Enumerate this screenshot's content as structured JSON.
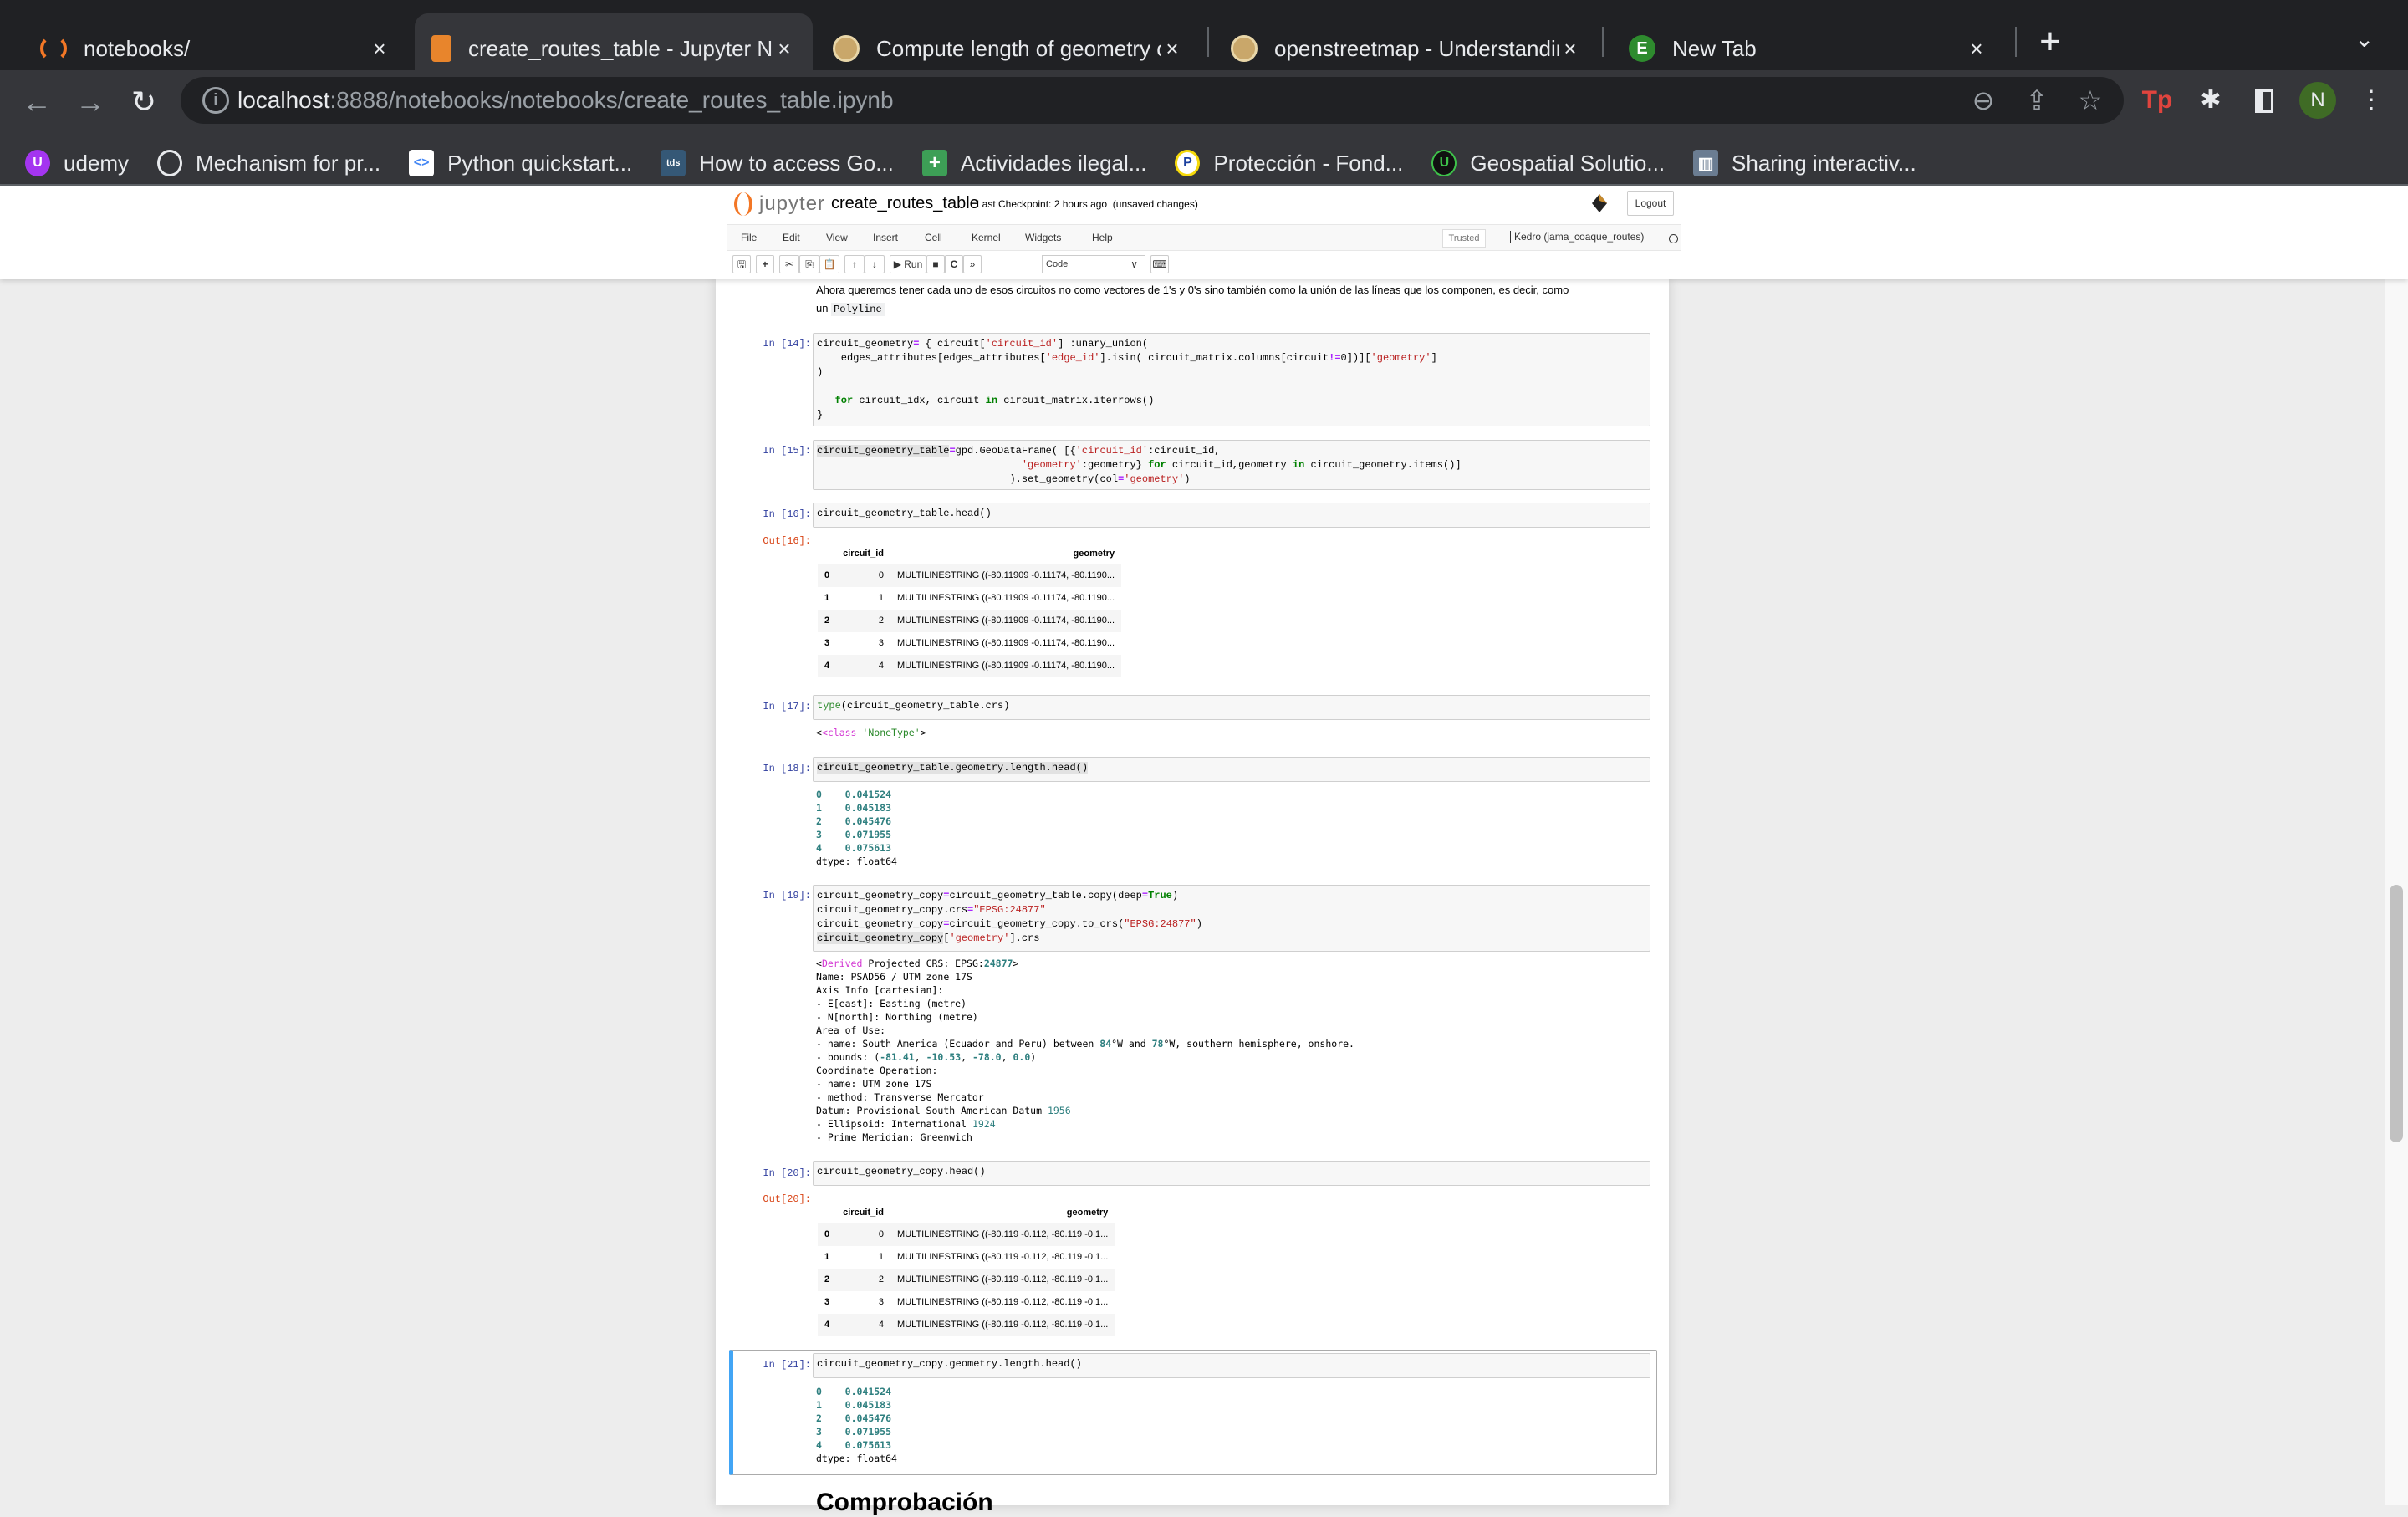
{
  "browser": {
    "tabs": [
      {
        "label": "notebooks/",
        "icon": "jupyter-icon",
        "active": false
      },
      {
        "label": "create_routes_table - Jupyter N",
        "icon": "notebook-icon",
        "active": true
      },
      {
        "label": "Compute length of geometry c",
        "icon": "gis-stackexchange-icon",
        "active": false
      },
      {
        "label": "openstreetmap - Understandin",
        "icon": "gis-stackexchange-icon",
        "active": false
      },
      {
        "label": "New Tab",
        "icon": "evernote-icon",
        "active": false
      }
    ],
    "close_glyph": "×",
    "new_tab_glyph": "+",
    "tab_search_glyph": "⌄",
    "url_host": "localhost",
    "url_rest": ":8888/notebooks/notebooks/create_routes_table.ipynb",
    "avatar_letter": "N",
    "bookmarks": [
      {
        "label": "udemy",
        "icon": "udemy-icon",
        "glyph": "U",
        "color": "#a435f0"
      },
      {
        "label": "Mechanism for pr...",
        "icon": "github-icon",
        "glyph": "◯",
        "color": "#35363a"
      },
      {
        "label": "Python quickstart...",
        "icon": "google-dev-icon",
        "glyph": "<>",
        "color": "#ffffff"
      },
      {
        "label": "How to access Go...",
        "icon": "tds-icon",
        "glyph": "tds",
        "color": "#355876"
      },
      {
        "label": "Actividades ilegal...",
        "icon": "google-sheets-icon",
        "glyph": "+",
        "color": "#3d9f56"
      },
      {
        "label": "Protección - Fond...",
        "icon": "p-icon",
        "glyph": "P",
        "color": "#f5d90a"
      },
      {
        "label": "Geospatial Solutio...",
        "icon": "geospatial-icon",
        "glyph": "U",
        "color": "#111111"
      },
      {
        "label": "Sharing interactiv...",
        "icon": "columns-icon",
        "glyph": "▥",
        "color": "#6b7d92"
      }
    ]
  },
  "jupyter": {
    "logo_text": "jupyter",
    "notebook_name": "create_routes_table",
    "checkpoint": "Last Checkpoint: 2 hours ago",
    "unsaved": "(unsaved changes)",
    "logout": "Logout",
    "menu": [
      "File",
      "Edit",
      "View",
      "Insert",
      "Cell",
      "Kernel",
      "Widgets",
      "Help"
    ],
    "trusted": "Trusted",
    "kernel": "Kedro (jama_coaque_routes)",
    "toolbar": {
      "save": "🖫",
      "add": "+",
      "cut": "✂",
      "copy": "⎘",
      "paste": "📋",
      "up": "🡑",
      "down": "🡓",
      "run": "▶ Run",
      "stop": "■",
      "restart": "C",
      "fastforward": "⏩",
      "cell_type": "Code",
      "cell_type_chevron": "∨",
      "keyboard": "⌨"
    }
  },
  "notebook": {
    "markdown_intro_line1": "Ahora queremos tener cada uno de esos circuitos no como vectores de 1's y 0's sino también como la unión de las líneas que los componen, es decir, como",
    "markdown_intro_line2_prefix": "un",
    "markdown_intro_code": "Polyline",
    "cells": {
      "c14": {
        "prompt": "In [14]:"
      },
      "c15": {
        "prompt": "In [15]:"
      },
      "c16": {
        "prompt": "In [16]:",
        "code": "circuit_geometry_table.head()",
        "out_prompt": "Out[16]:"
      },
      "c17": {
        "prompt": "In [17]:",
        "out_class": "<class",
        "out_type": "'NoneType'",
        "out_end": ">"
      },
      "c18": {
        "prompt": "In [18]:",
        "code": "circuit_geometry_table.geometry.length.head()"
      },
      "c19": {
        "prompt": "In [19]:"
      },
      "c20": {
        "prompt": "In [20]:",
        "code": "circuit_geometry_copy.head()",
        "out_prompt": "Out[20]:"
      },
      "c21": {
        "prompt": "In [21]:",
        "code": "circuit_geometry_copy.geometry.length.head()"
      }
    },
    "table16": {
      "columns": [
        "",
        "circuit_id",
        "geometry"
      ],
      "rows": [
        [
          "0",
          "0",
          "MULTILINESTRING ((-80.11909 -0.11174, -80.1190..."
        ],
        [
          "1",
          "1",
          "MULTILINESTRING ((-80.11909 -0.11174, -80.1190..."
        ],
        [
          "2",
          "2",
          "MULTILINESTRING ((-80.11909 -0.11174, -80.1190..."
        ],
        [
          "3",
          "3",
          "MULTILINESTRING ((-80.11909 -0.11174, -80.1190..."
        ],
        [
          "4",
          "4",
          "MULTILINESTRING ((-80.11909 -0.11174, -80.1190..."
        ]
      ]
    },
    "table20": {
      "columns": [
        "",
        "circuit_id",
        "geometry"
      ],
      "rows": [
        [
          "0",
          "0",
          "MULTILINESTRING ((-80.119 -0.112, -80.119 -0.1..."
        ],
        [
          "1",
          "1",
          "MULTILINESTRING ((-80.119 -0.112, -80.119 -0.1..."
        ],
        [
          "2",
          "2",
          "MULTILINESTRING ((-80.119 -0.112, -80.119 -0.1..."
        ],
        [
          "3",
          "3",
          "MULTILINESTRING ((-80.119 -0.112, -80.119 -0.1..."
        ],
        [
          "4",
          "4",
          "MULTILINESTRING ((-80.119 -0.112, -80.119 -0.1..."
        ]
      ]
    },
    "lengths": {
      "index": [
        "0",
        "1",
        "2",
        "3",
        "4"
      ],
      "values": [
        "0.041524",
        "0.045183",
        "0.045476",
        "0.071955",
        "0.075613"
      ],
      "dtype": "dtype: float64"
    },
    "crs_output": {
      "derived": "Derived",
      "header_rest": " Projected CRS: EPSG:",
      "epsg": "24877",
      "name_line": "Name: PSAD56 / UTM zone 17S",
      "axis": "Axis Info [cartesian]:",
      "east": "- E[east]: Easting (metre)",
      "north": "- N[north]: Northing (metre)",
      "area": "Area of Use:",
      "area_name_pre": "- name: South America (Ecuador and Peru) between ",
      "lon_w": "84",
      "area_mid": "°W and ",
      "lon_e": "78",
      "area_post": "°W, southern hemisphere, onshore.",
      "bounds_pre": "- bounds: (",
      "bounds": [
        "-81.41",
        "-10.53",
        "-78.0",
        "0.0"
      ],
      "coord_op": "Coordinate Operation:",
      "op_name": "- name: UTM zone 17S",
      "op_method": "- method: Transverse Mercator",
      "datum_pre": "Datum: Provisional South American Datum ",
      "datum_year": "1956",
      "ellipsoid_pre": "- Ellipsoid: International ",
      "ellipsoid_year": "1924",
      "meridian": "- Prime Meridian: Greenwich"
    },
    "next_heading": "Comprobación"
  }
}
